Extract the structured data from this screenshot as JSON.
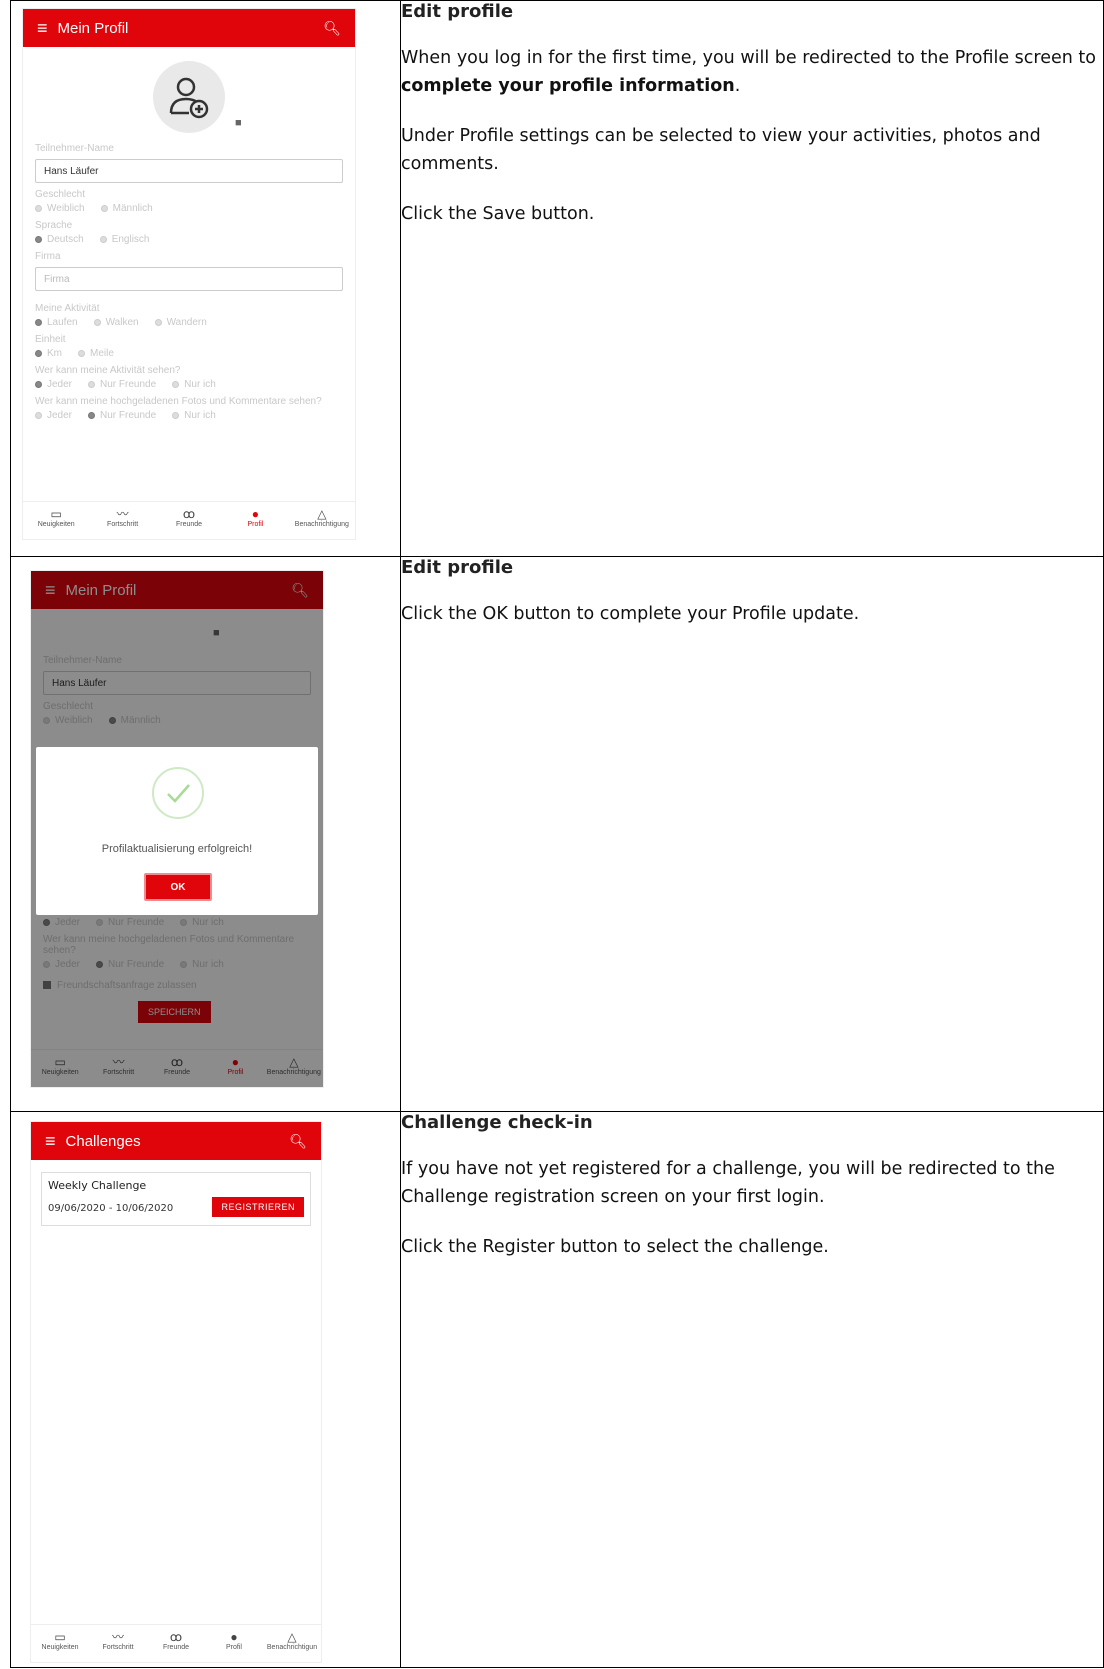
{
  "rows": [
    {
      "heading": "Edit profile",
      "p1_pre": "When you log in for the first time, you will be redirected to the Profile screen to ",
      "p1_bold": "complete your profile information",
      "p1_post": ".",
      "p2": "Under Profile settings can be selected to view your activities, photos and comments.",
      "p3": "Click the Save button."
    },
    {
      "heading": "Edit profile",
      "p1": "Click the OK button to complete your Profile update."
    },
    {
      "heading": "Challenge check-in",
      "p1": "If you have not yet registered for a challenge, you will be redirected to the Challenge registration screen on your first login.",
      "p2": "Click the Register button to select the challenge."
    }
  ],
  "profile": {
    "app_title": "Mein Profil",
    "name_label": "Teilnehmer-Name",
    "name_value": "Hans Läufer",
    "gender_label": "Geschlecht",
    "gender_opts": [
      "Weiblich",
      "Männlich"
    ],
    "lang_label": "Sprache",
    "lang_opts": [
      "Deutsch",
      "Englisch"
    ],
    "company_label": "Firma",
    "company_placeholder": "Firma",
    "activity_label": "Meine Aktivität",
    "activity_opts": [
      "Laufen",
      "Walken",
      "Wandern"
    ],
    "unit_label": "Einheit",
    "unit_opts": [
      "Km",
      "Meile"
    ],
    "visibility_label": "Wer kann meine Aktivität sehen?",
    "visibility_opts": [
      "Jeder",
      "Nur Freunde",
      "Nur ich"
    ],
    "photos_label": "Wer kann meine hochgeladenen Fotos und Kommentare sehen?",
    "photos_opts": [
      "Jeder",
      "Nur Freunde",
      "Nur ich"
    ],
    "friend_req": "Freundschaftsanfrage zulassen",
    "save_btn": "SPEICHERN",
    "success_msg": "Profilaktualisierung erfolgreich!",
    "ok_btn": "OK"
  },
  "nav": {
    "news": "Neuigkeiten",
    "progress": "Fortschritt",
    "friends": "Freunde",
    "profile": "Profil",
    "notifications": "Benachrichtigung",
    "notifications_cut": "Benachrichtigun"
  },
  "challenges": {
    "app_title": "Challenges",
    "card_title": "Weekly Challenge",
    "card_dates": "09/06/2020 - 10/06/2020",
    "register_btn": "REGISTRIEREN"
  },
  "colors": {
    "brand_red": "#e0040b"
  }
}
